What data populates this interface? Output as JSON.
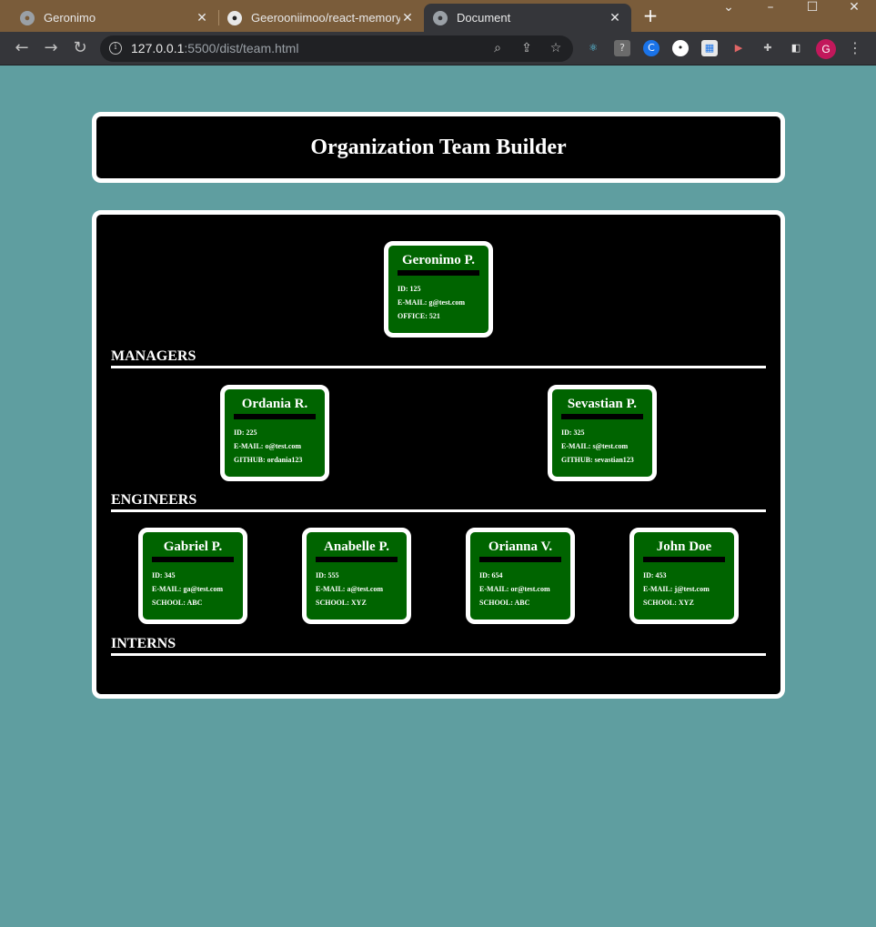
{
  "browser": {
    "tabs": [
      {
        "title": "Geronimo",
        "icon": "globe-icon",
        "active": false
      },
      {
        "title": "Geerooniimoo/react-memory-",
        "icon": "github-icon",
        "active": false
      },
      {
        "title": "Document",
        "icon": "globe-icon",
        "active": true
      }
    ],
    "url_host": "127.0.0.1",
    "url_path": ":5500/dist/team.html",
    "profile_initial": "G"
  },
  "page": {
    "title": "Organization Team Builder",
    "lead": {
      "name": "Geronimo P.",
      "id": "ID: 125",
      "email": "E-MAIL: g@test.com",
      "extra": "OFFICE: 521"
    },
    "sections": {
      "managers": "MANAGERS",
      "engineers": "ENGINEERS",
      "interns": "INTERNS"
    },
    "engineers": [
      {
        "name": "Ordania R.",
        "id": "ID: 225",
        "email": "E-MAIL: o@test.com",
        "extra": "GITHUB: ordania123"
      },
      {
        "name": "Sevastian P.",
        "id": "ID: 325",
        "email": "E-MAIL: s@test.com",
        "extra": "GITHUB: sevastian123"
      }
    ],
    "interns": [
      {
        "name": "Gabriel P.",
        "id": "ID: 345",
        "email": "E-MAIL: ga@test.com",
        "extra": "SCHOOL: ABC"
      },
      {
        "name": "Anabelle P.",
        "id": "ID: 555",
        "email": "E-MAIL: a@test.com",
        "extra": "SCHOOL: XYZ"
      },
      {
        "name": "Orianna V.",
        "id": "ID: 654",
        "email": "E-MAIL: or@test.com",
        "extra": "SCHOOL: ABC"
      },
      {
        "name": "John Doe",
        "id": "ID: 453",
        "email": "E-MAIL: j@test.com",
        "extra": "SCHOOL: XYZ"
      }
    ]
  }
}
